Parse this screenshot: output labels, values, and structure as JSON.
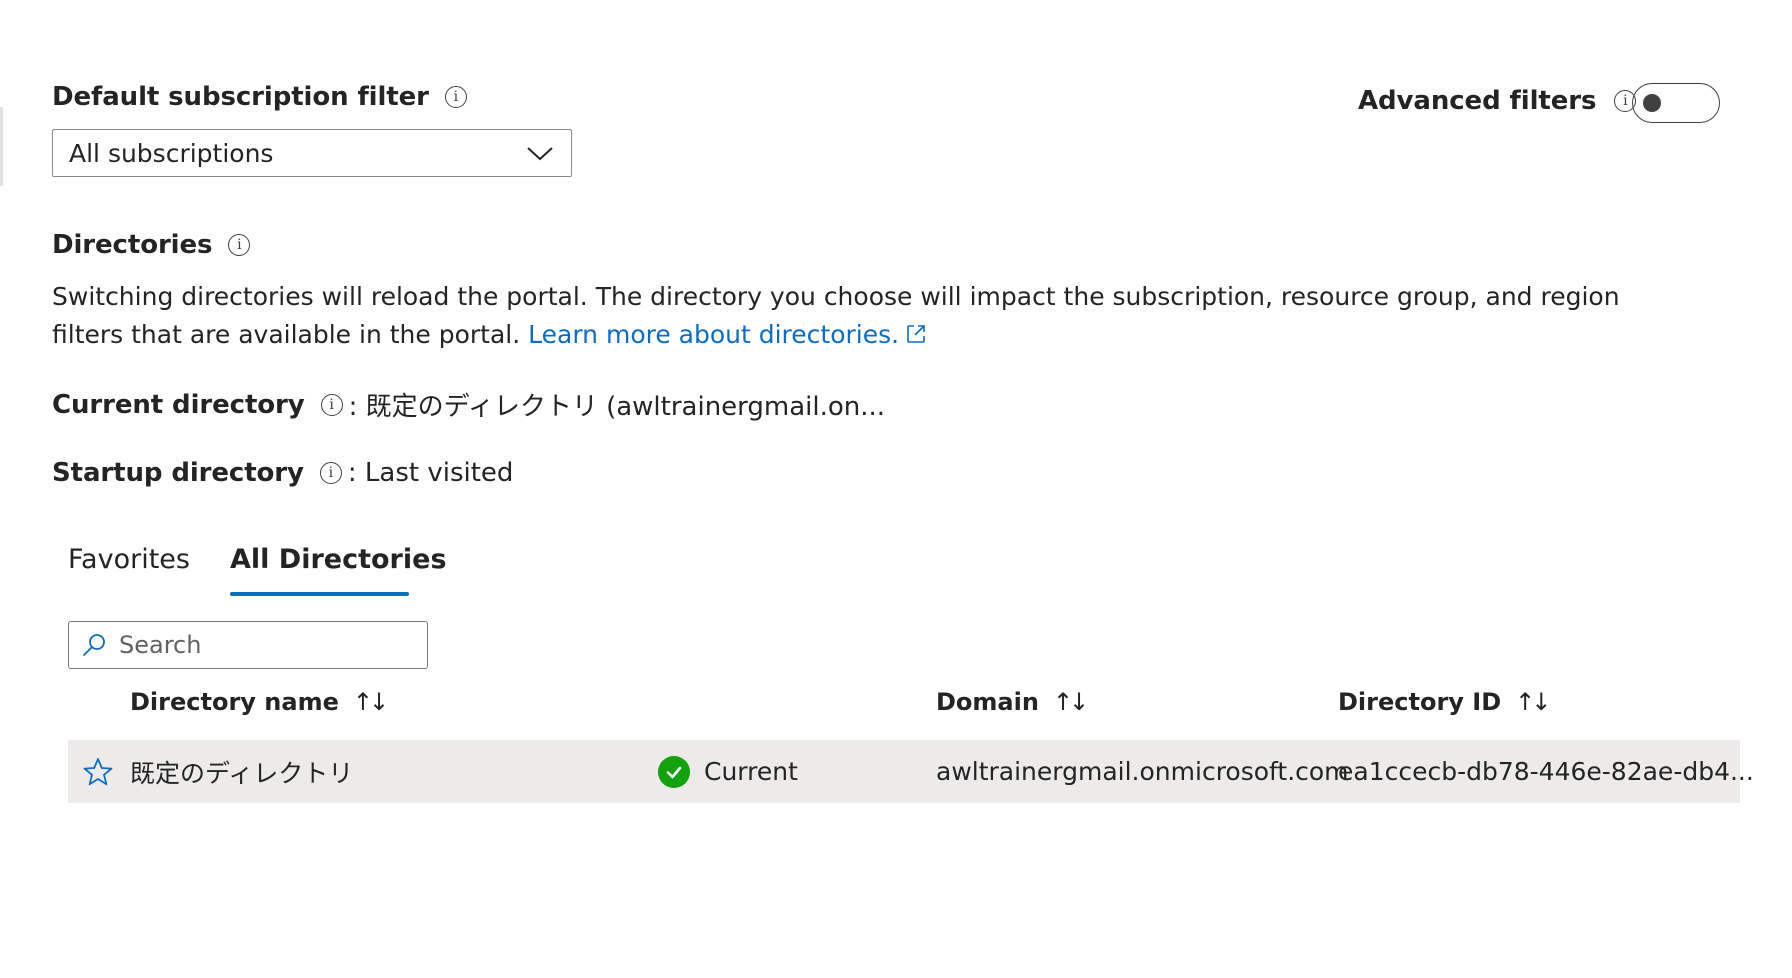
{
  "subscription_filter": {
    "label": "Default subscription filter",
    "selected": "All subscriptions"
  },
  "advanced_filters": {
    "label": "Advanced filters",
    "enabled": false
  },
  "directories": {
    "heading": "Directories",
    "description": "Switching directories will reload the portal. The directory you choose will impact the subscription, resource group, and region filters that are available in the portal.",
    "learn_more_link": "Learn more about directories."
  },
  "current_directory": {
    "label": "Current directory",
    "value": ": 既定のディレクトリ (awltrainergmail.on..."
  },
  "startup_directory": {
    "label": "Startup directory",
    "value": ": Last visited"
  },
  "tabs": [
    {
      "label": "Favorites",
      "active": false
    },
    {
      "label": "All Directories",
      "active": true
    }
  ],
  "search": {
    "placeholder": "Search",
    "value": ""
  },
  "table": {
    "columns": [
      {
        "label": "Directory name"
      },
      {
        "label": "Domain"
      },
      {
        "label": "Directory ID"
      }
    ],
    "rows": [
      {
        "name": "既定のディレクトリ",
        "status": "Current",
        "domain": "awltrainergmail.onmicrosoft.com",
        "directory_id": "ea1ccecb-db78-446e-82ae-db4..."
      }
    ]
  },
  "icons": {
    "info": "info-icon",
    "chevron": "chevron-down-icon",
    "external": "external-link-icon",
    "search": "search-icon",
    "sort": "sort-icon",
    "star": "star-icon",
    "check": "check-circle-icon"
  },
  "colors": {
    "accent": "#0f6cbd",
    "success": "#13a10e",
    "row_highlight": "#edebe9"
  }
}
